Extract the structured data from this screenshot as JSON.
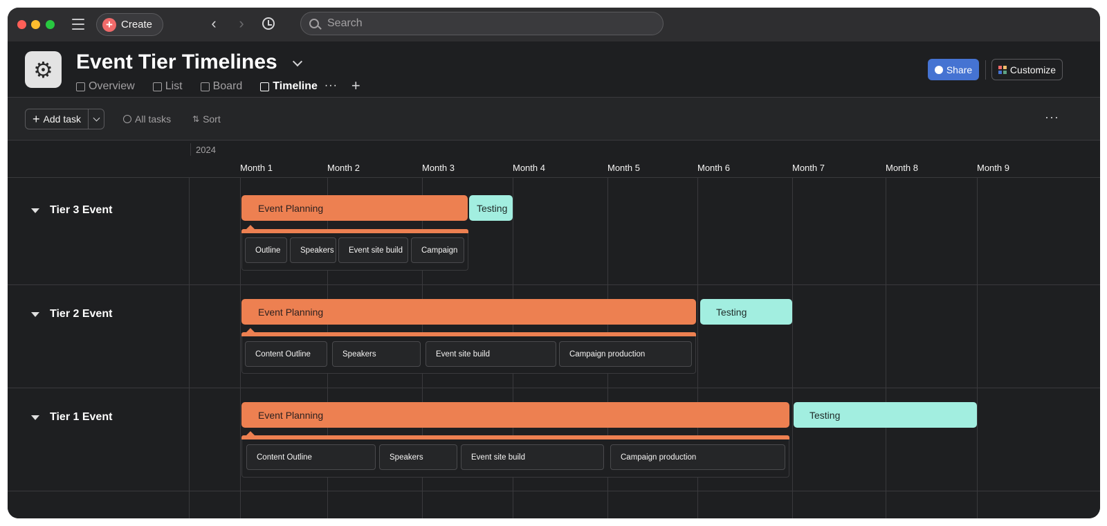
{
  "topbar": {
    "create_label": "Create",
    "search_placeholder": "Search"
  },
  "project": {
    "title": "Event Tier Timelines",
    "tabs": [
      {
        "label": "Overview"
      },
      {
        "label": "List"
      },
      {
        "label": "Board"
      },
      {
        "label": "Timeline",
        "active": true
      }
    ],
    "tab_more": "···",
    "tab_add": "+",
    "share_label": "Share",
    "customize_label": "Customize"
  },
  "toolbar": {
    "add_task_label": "Add task",
    "all_tasks_label": "All tasks",
    "sort_label": "Sort",
    "more": "···"
  },
  "timeline": {
    "year": "2024",
    "months": [
      "Month 1",
      "Month 2",
      "Month 3",
      "Month 4",
      "Month 5",
      "Month 6",
      "Month 7",
      "Month 8",
      "Month 9"
    ],
    "sections": [
      {
        "name": "Tier 3 Event",
        "planning_label": "Event Planning",
        "testing_label": "Testing",
        "subtasks": [
          "Outline",
          "Speakers",
          "Event site build",
          "Campaign"
        ]
      },
      {
        "name": "Tier 2 Event",
        "planning_label": "Event Planning",
        "testing_label": "Testing",
        "subtasks": [
          "Content Outline",
          "Speakers",
          "Event site build",
          "Campaign production"
        ]
      },
      {
        "name": "Tier 1 Event",
        "planning_label": "Event Planning",
        "testing_label": "Testing",
        "subtasks": [
          "Content Outline",
          "Speakers",
          "Event site build",
          "Campaign production"
        ]
      }
    ]
  },
  "colors": {
    "planning": "#ed8051",
    "testing": "#a2eee0",
    "share": "#4573d2",
    "create_plus": "#f06a6a"
  }
}
